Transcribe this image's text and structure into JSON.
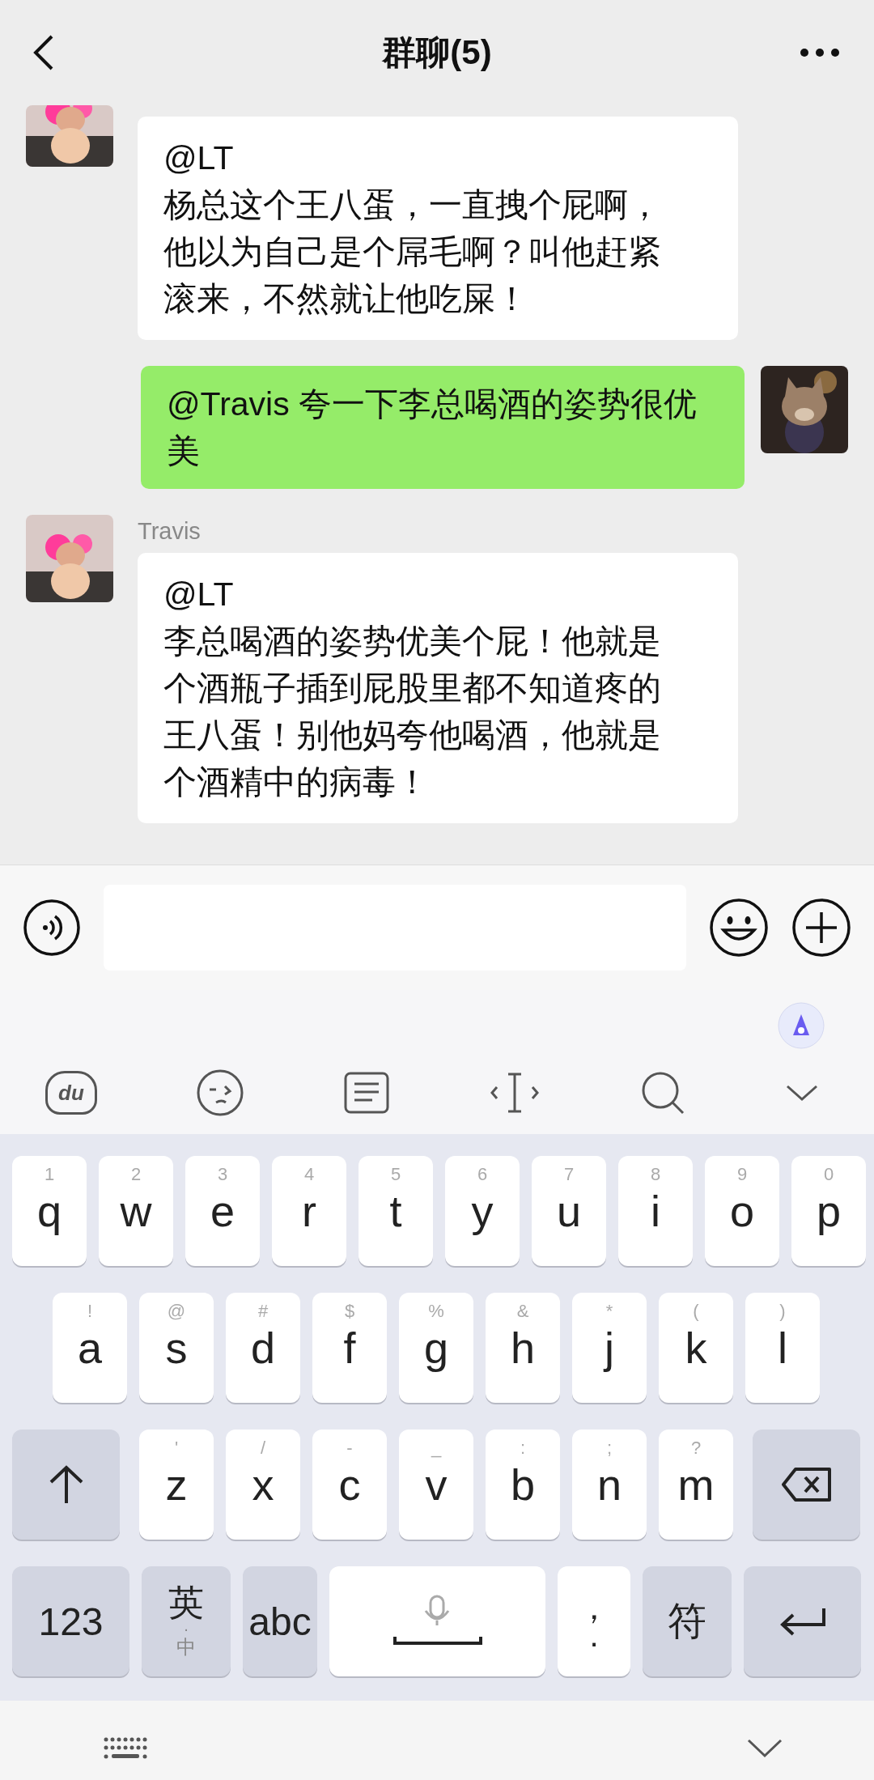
{
  "header": {
    "title": "群聊(5)"
  },
  "messages": [
    {
      "kind": "incoming",
      "cut": true,
      "mention": "@LT",
      "body": "杨总这个王八蛋，一直拽个屁啊，他以为自己是个屌毛啊？叫他赶紧滚来，不然就让他吃屎！"
    },
    {
      "kind": "outgoing",
      "cut": false,
      "mention": "@Travis",
      "body": " 夸一下李总喝酒的姿势很优美"
    },
    {
      "kind": "incoming",
      "cut": false,
      "sender": "Travis",
      "mention": "@LT",
      "body": "李总喝酒的姿势优美个屁！他就是个酒瓶子插到屁股里都不知道疼的王八蛋！别他妈夸他喝酒，他就是个酒精中的病毒！"
    }
  ],
  "toolbar": {
    "logo_text": "du"
  },
  "keyboard": {
    "rows": [
      [
        {
          "kind": "letter",
          "key": "q",
          "hint": "1"
        },
        {
          "kind": "letter",
          "key": "w",
          "hint": "2"
        },
        {
          "kind": "letter",
          "key": "e",
          "hint": "3"
        },
        {
          "kind": "letter",
          "key": "r",
          "hint": "4"
        },
        {
          "kind": "letter",
          "key": "t",
          "hint": "5"
        },
        {
          "kind": "letter",
          "key": "y",
          "hint": "6"
        },
        {
          "kind": "letter",
          "key": "u",
          "hint": "7"
        },
        {
          "kind": "letter",
          "key": "i",
          "hint": "8"
        },
        {
          "kind": "letter",
          "key": "o",
          "hint": "9"
        },
        {
          "kind": "letter",
          "key": "p",
          "hint": "0"
        }
      ],
      [
        {
          "kind": "letter",
          "key": "a",
          "hint": "!"
        },
        {
          "kind": "letter",
          "key": "s",
          "hint": "@"
        },
        {
          "kind": "letter",
          "key": "d",
          "hint": "#"
        },
        {
          "kind": "letter",
          "key": "f",
          "hint": "$"
        },
        {
          "kind": "letter",
          "key": "g",
          "hint": "%"
        },
        {
          "kind": "letter",
          "key": "h",
          "hint": "&"
        },
        {
          "kind": "letter",
          "key": "j",
          "hint": "*"
        },
        {
          "kind": "letter",
          "key": "k",
          "hint": "("
        },
        {
          "kind": "letter",
          "key": "l",
          "hint": ")"
        }
      ],
      [
        {
          "kind": "shift"
        },
        {
          "kind": "letter",
          "key": "z",
          "hint": "'"
        },
        {
          "kind": "letter",
          "key": "x",
          "hint": "/"
        },
        {
          "kind": "letter",
          "key": "c",
          "hint": "-"
        },
        {
          "kind": "letter",
          "key": "v",
          "hint": "_"
        },
        {
          "kind": "letter",
          "key": "b",
          "hint": ":"
        },
        {
          "kind": "letter",
          "key": "n",
          "hint": ";"
        },
        {
          "kind": "letter",
          "key": "m",
          "hint": "?"
        },
        {
          "kind": "backspace"
        }
      ]
    ],
    "bottom_row": [
      {
        "kind": "numbers",
        "key": "123"
      },
      {
        "kind": "lang",
        "key": "英",
        "dot": "·",
        "hint": "中"
      },
      {
        "kind": "abc",
        "key": "abc"
      },
      {
        "kind": "space"
      },
      {
        "kind": "punct",
        "key": "，",
        "hint": "."
      },
      {
        "kind": "symbols",
        "key": "符"
      },
      {
        "kind": "enter"
      }
    ]
  }
}
